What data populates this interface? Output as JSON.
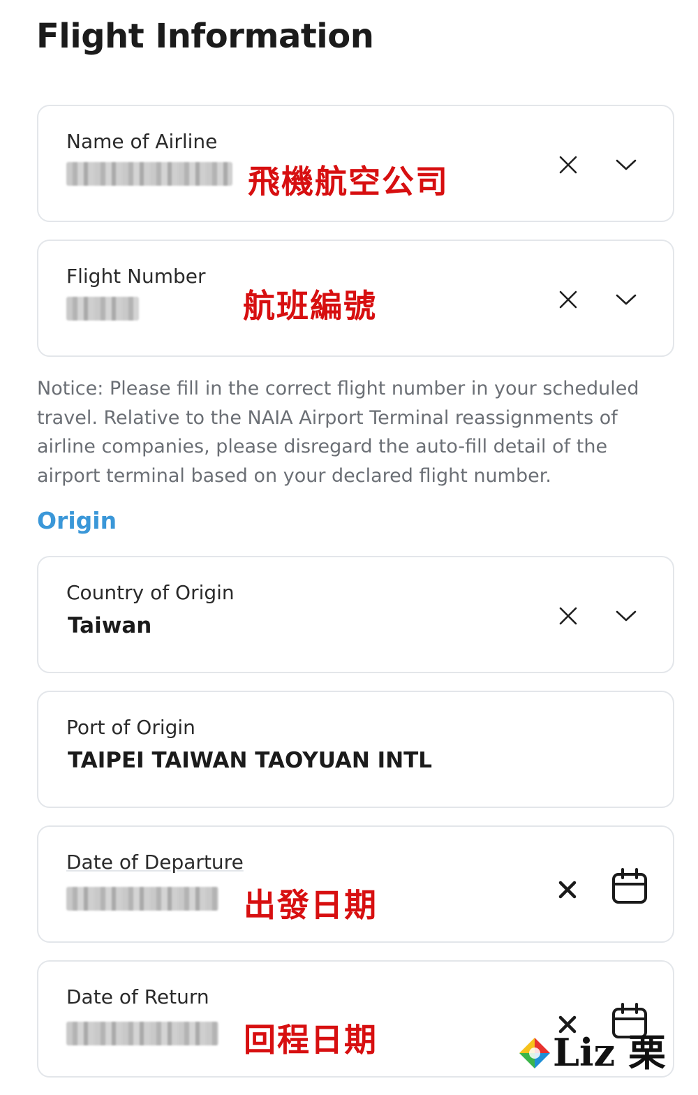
{
  "page": {
    "title": "Flight Information"
  },
  "fields": {
    "airline": {
      "label": "Name of Airline",
      "annotation": "飛機航空公司"
    },
    "flight_number": {
      "label": "Flight Number",
      "annotation": "航班編號"
    },
    "country_of_origin": {
      "label": "Country of Origin",
      "value": "Taiwan"
    },
    "port_of_origin": {
      "label": "Port of Origin",
      "value": "TAIPEI TAIWAN TAOYUAN INTL"
    },
    "departure_date": {
      "label": "Date of Departure",
      "annotation": "出發日期"
    },
    "return_date": {
      "label": "Date of Return",
      "annotation": "回程日期"
    }
  },
  "notice": "Notice: Please fill in the correct flight number in your scheduled travel. Relative to the NAIA Airport Terminal reassignments of airline companies, please disregard the auto-fill detail of the airport terminal based on your declared flight number.",
  "sections": {
    "origin": "Origin"
  },
  "watermark": {
    "text": "Liz 栗"
  },
  "icons": {
    "clear": "close-icon",
    "dropdown": "chevron-down-icon",
    "calendar": "calendar-icon",
    "logo": "liz-logo-icon"
  },
  "colors": {
    "accent": "#3a97d8",
    "annotation": "#d70f10",
    "border": "#e3e6ea",
    "notice_text": "#6b6f75"
  }
}
